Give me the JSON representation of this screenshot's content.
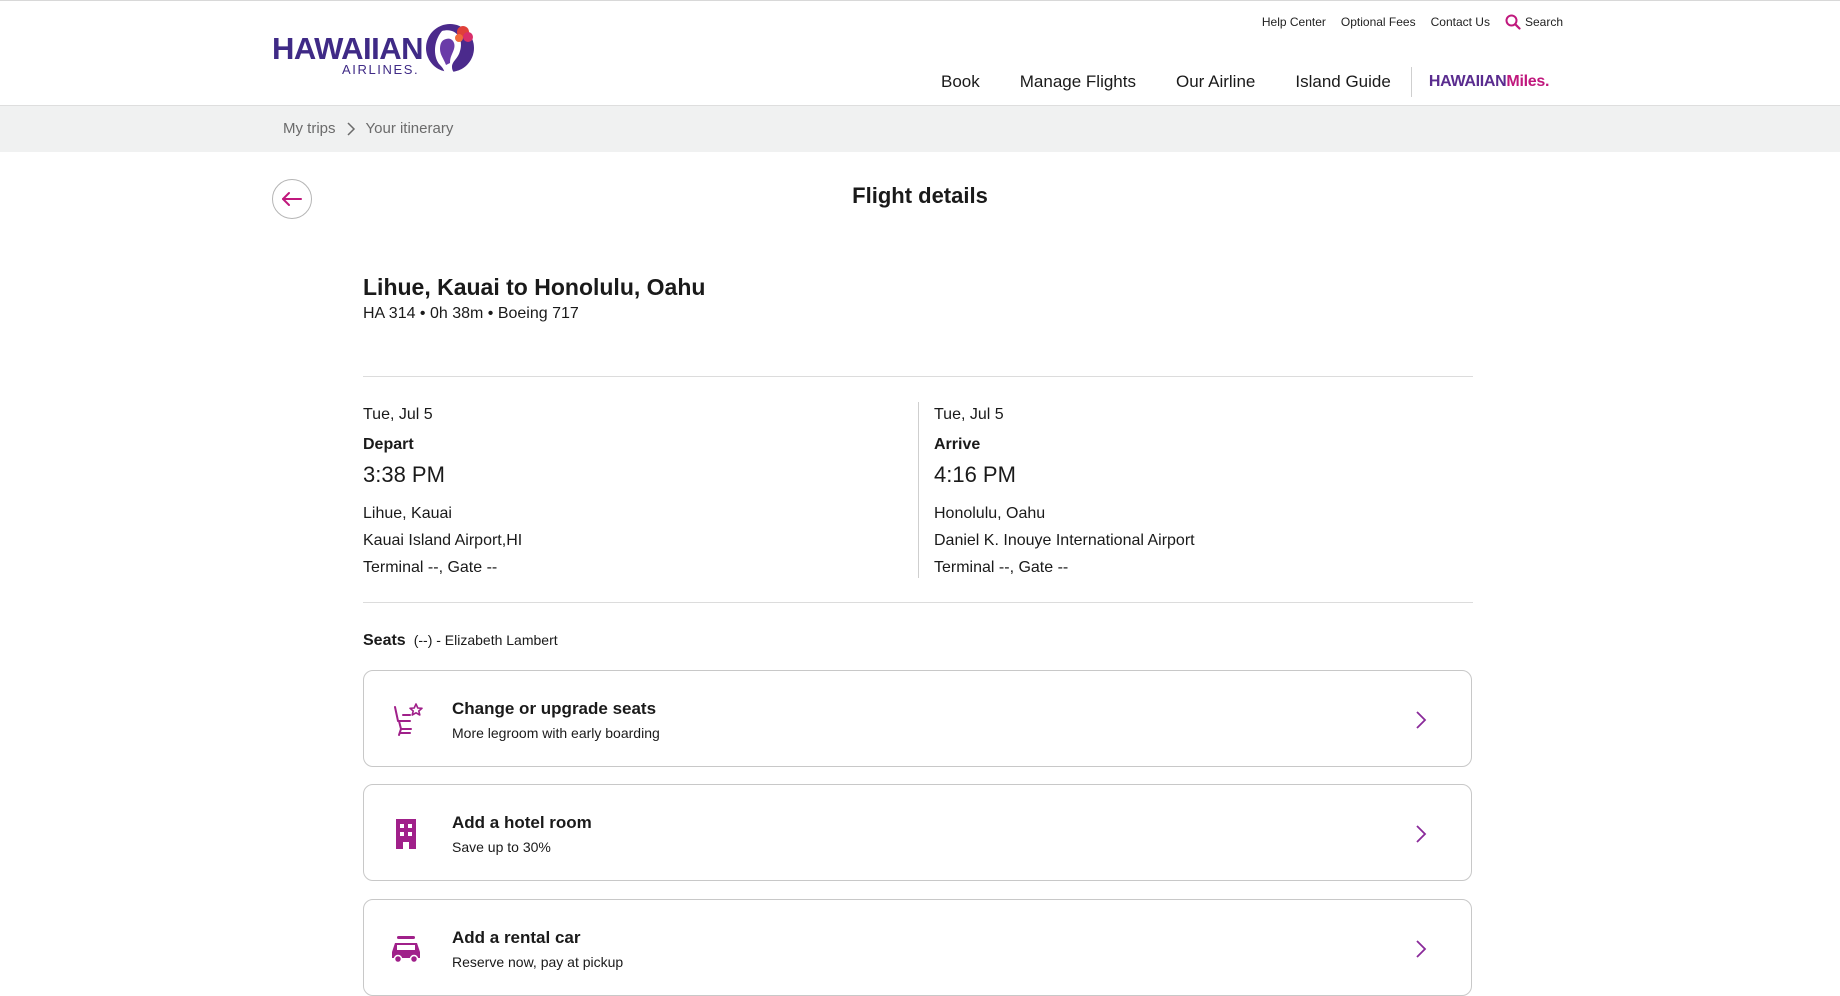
{
  "brand": {
    "name_primary": "HAWAIIAN",
    "name_secondary": "AIRLINES.",
    "primary_color": "#3f2a86",
    "accent_color": "#c0187d"
  },
  "utility_nav": {
    "items": [
      "Help Center",
      "Optional Fees",
      "Contact Us"
    ],
    "search_label": "Search"
  },
  "main_nav": {
    "items": [
      "Book",
      "Manage Flights",
      "Our Airline",
      "Island Guide"
    ],
    "miles_part1": "HAWAIIAN",
    "miles_part2": "Miles."
  },
  "breadcrumb": {
    "items": [
      "My trips",
      "Your itinerary"
    ]
  },
  "page": {
    "title": "Flight details"
  },
  "flight": {
    "route": "Lihue, Kauai to Honolulu, Oahu",
    "meta": "HA 314 • 0h 38m • Boeing 717",
    "depart": {
      "date": "Tue, Jul 5",
      "label": "Depart",
      "time": "3:38 PM",
      "city": "Lihue, Kauai",
      "airport": "Kauai Island Airport,HI",
      "terminal_gate": "Terminal --, Gate --"
    },
    "arrive": {
      "date": "Tue, Jul 5",
      "label": "Arrive",
      "time": "4:16 PM",
      "city": "Honolulu, Oahu",
      "airport": "Daniel K. Inouye International Airport",
      "terminal_gate": "Terminal --, Gate --"
    }
  },
  "seats": {
    "label": "Seats",
    "value": "(--) - Elizabeth Lambert"
  },
  "cards": [
    {
      "title": "Change or upgrade seats",
      "subtitle": "More legroom with early boarding",
      "icon": "seat-star-icon"
    },
    {
      "title": "Add a hotel room",
      "subtitle": "Save up to 30%",
      "icon": "hotel-icon"
    },
    {
      "title": "Add a rental car",
      "subtitle": "Reserve now, pay at pickup",
      "icon": "car-icon"
    }
  ]
}
